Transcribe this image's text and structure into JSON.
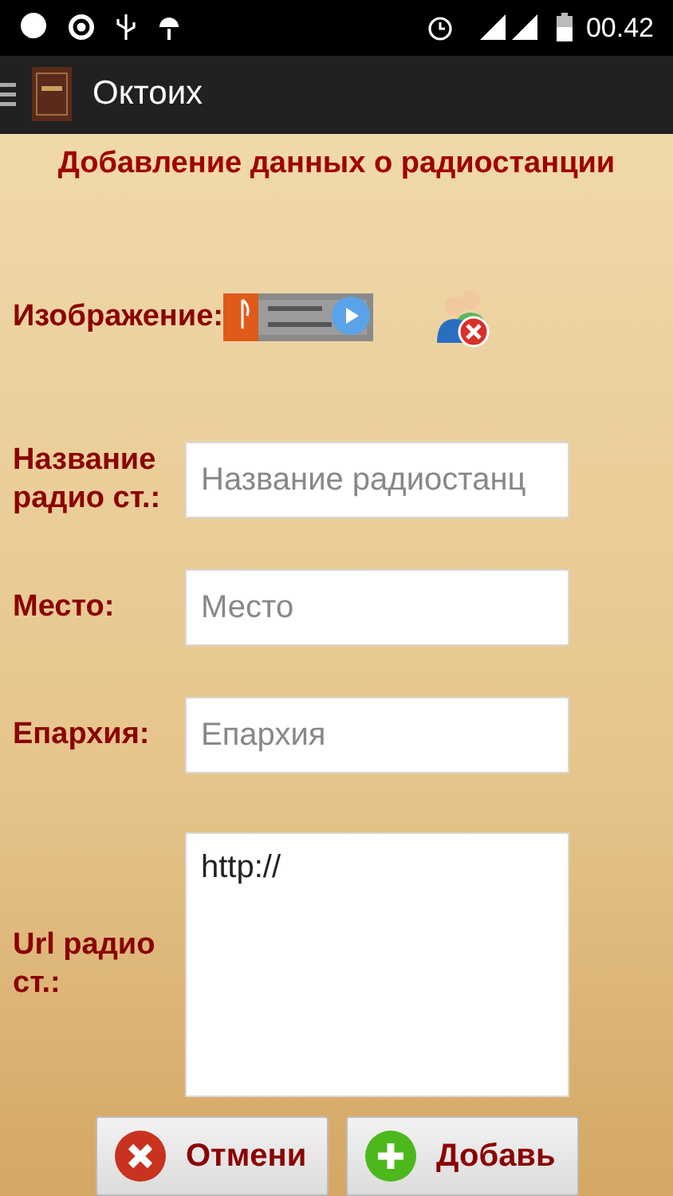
{
  "status_bar": {
    "time": "00.42"
  },
  "app_bar": {
    "title": "Октоих"
  },
  "form": {
    "heading": "Добавление данных о радиостанции",
    "image_label": "Изображение:",
    "fields": [
      {
        "kind": "input",
        "label": "Название радио ст.:",
        "placeholder": "Название радиостанц"
      },
      {
        "kind": "input",
        "label": "Место:",
        "placeholder": "Место"
      },
      {
        "kind": "input",
        "label": "Епархия:",
        "placeholder": "Епархия"
      },
      {
        "kind": "textarea",
        "label": "Url радио ст.:",
        "value": "http://"
      }
    ]
  },
  "buttons": [
    {
      "kind": "cancel",
      "label": "Отмени"
    },
    {
      "kind": "add",
      "label": "Добавь"
    }
  ]
}
